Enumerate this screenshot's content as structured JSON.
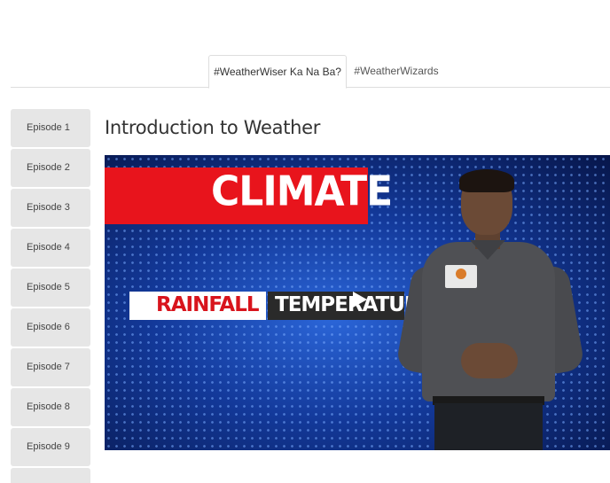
{
  "tabs": [
    {
      "label": "#WeatherWiser Ka Na Ba?",
      "active": true
    },
    {
      "label": "#WeatherWizards",
      "active": false
    }
  ],
  "episodes": [
    {
      "label": "Episode 1"
    },
    {
      "label": "Episode 2"
    },
    {
      "label": "Episode 3"
    },
    {
      "label": "Episode 4"
    },
    {
      "label": "Episode 5"
    },
    {
      "label": "Episode 6"
    },
    {
      "label": "Episode 7"
    },
    {
      "label": "Episode 8"
    },
    {
      "label": "Episode 9"
    }
  ],
  "content": {
    "title": "Introduction to Weather"
  },
  "video": {
    "banner_text": "CLIMATE",
    "sub_left": "RAINFALL",
    "sub_right": "TEMPERATURE",
    "play_icon": "play-icon"
  },
  "colors": {
    "banner_red": "#e8141c",
    "video_blue": "#13399a",
    "episode_bg": "#e6e6e6"
  }
}
